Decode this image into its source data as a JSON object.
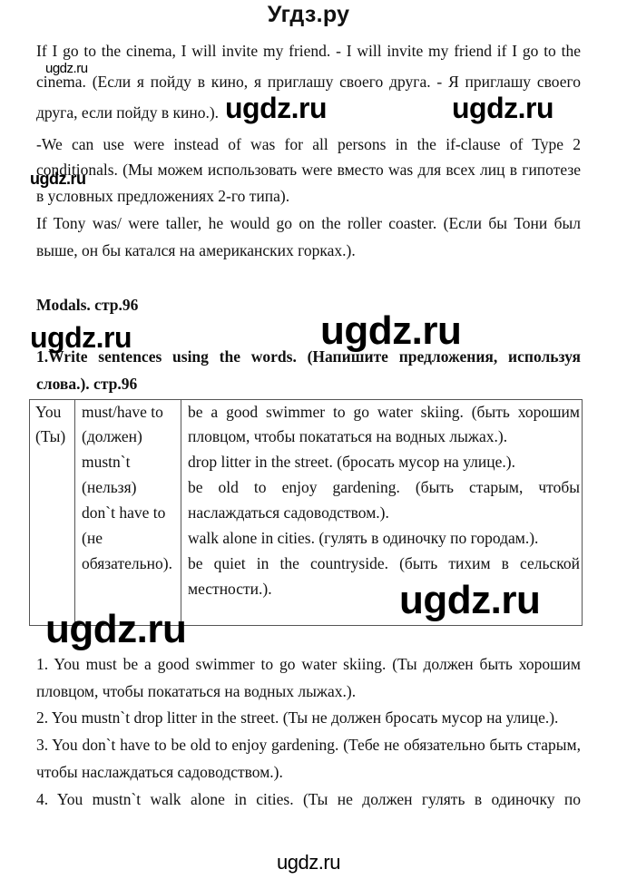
{
  "header": {
    "site_title": "Угдз.ру"
  },
  "intro": {
    "line1": "If I go to the cinema, I will invite my friend. - I will invite my friend if I go to the",
    "line2": "cinema. (Если я пойду в кино, я приглашу своего друга. - Я приглашу своего",
    "line3": "друга, если пойду в кино.).",
    "line4": "-We can use were instead of was for all persons in the if-clause of Type 2",
    "line5": "conditionals. (Мы можем использовать were вместо was для всех лиц в гипотезе",
    "line6": "в условных предложениях 2-го типа).",
    "line7": "If Tony was/ were taller, he would go on the roller coaster. (Если бы Тони был",
    "line8": "выше, он бы катался на американских горках.)."
  },
  "section": {
    "heading": "Modals. стр.96",
    "task_line1": "1.Write sentences using the words. (Напишите предложения, используя",
    "task_line2": "слова.). стр.96"
  },
  "table": {
    "col1": [
      "You",
      "(Ты)"
    ],
    "col2": [
      "must/have to",
      "(должен)",
      "mustn`t",
      "(нельзя)",
      "don`t have to",
      "(не",
      "обязательно)."
    ],
    "col3": [
      "be a good swimmer to go water skiing. (быть хорошим",
      "пловцом, чтобы покататься на водных лыжах.).",
      "drop litter in the street. (бросать мусор на улице.).",
      "be old to enjoy gardening. (быть старым, чтобы",
      "наслаждаться садоводством.).",
      "walk alone in cities. (гулять в одиночку по городам.).",
      "be quiet in the countryside. (быть тихим в сельской",
      "местности.)."
    ]
  },
  "answers": {
    "a1_line1": "1. You must be a good swimmer to go water skiing. (Ты должен быть хорошим",
    "a1_line2": "пловцом, чтобы покататься на водных лыжах.).",
    "a2_line1": "2. You mustn`t drop litter in the street. (Ты не должен бросать мусор на улице.).",
    "a3_line1": "3. You don`t have to be old to enjoy gardening. (Тебе не обязательно быть старым,",
    "a3_line2": "чтобы наслаждаться садоводством.).",
    "a4_line1": "4. You mustn`t walk alone in cities. (Ты не должен гулять в одиночку по"
  },
  "watermarks": {
    "small_1": "ugdz.ru",
    "mid_1": "ugdz.ru",
    "mid_2": "ugdz.ru",
    "small_2": "ugdz.ru",
    "left_1": "ugdz.ru",
    "center_large": "ugdz.ru",
    "table_right": "ugdz.ru",
    "table_left": "ugdz.ru",
    "footer": "ugdz.ru"
  }
}
